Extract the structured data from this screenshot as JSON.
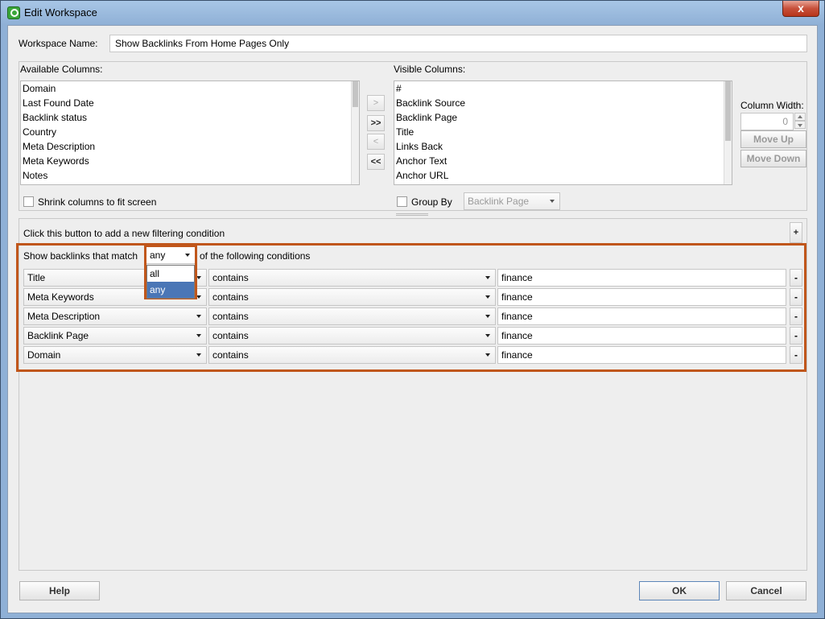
{
  "window": {
    "title": "Edit Workspace",
    "close_glyph": "x"
  },
  "workspace_name": {
    "label": "Workspace Name:",
    "value": "Show Backlinks From Home Pages Only"
  },
  "available_columns": {
    "label": "Available Columns:",
    "items": [
      "Domain",
      "Last Found Date",
      "Backlink status",
      "Country",
      "Meta Description",
      "Meta Keywords",
      "Notes"
    ]
  },
  "visible_columns": {
    "label": "Visible Columns:",
    "items": [
      "#",
      "Backlink Source",
      "Backlink Page",
      "Title",
      "Links Back",
      "Anchor Text",
      "Anchor URL"
    ]
  },
  "transfer_buttons": {
    "move_right": ">",
    "move_all_right": ">>",
    "move_left": "<",
    "move_all_left": "<<"
  },
  "column_width": {
    "label": "Column Width:",
    "value": "0"
  },
  "move_up_label": "Move Up",
  "move_down_label": "Move Down",
  "shrink_columns_label": "Shrink columns to fit screen",
  "group_by": {
    "label": "Group By",
    "value": "Backlink Page"
  },
  "filter": {
    "add_hint": "Click this button to add a new filtering condition",
    "add_label": "+",
    "match_prefix": "Show backlinks that match",
    "match_value": "any",
    "match_suffix": "of the following conditions",
    "match_options": [
      "all",
      "any"
    ],
    "selected_option": "any",
    "remove_label": "-",
    "conditions": [
      {
        "field": "Title",
        "operator": "contains",
        "value": "finance"
      },
      {
        "field": "Meta Keywords",
        "operator": "contains",
        "value": "finance"
      },
      {
        "field": "Meta Description",
        "operator": "contains",
        "value": "finance"
      },
      {
        "field": "Backlink Page",
        "operator": "contains",
        "value": "finance"
      },
      {
        "field": "Domain",
        "operator": "contains",
        "value": "finance"
      }
    ]
  },
  "footer": {
    "help_label": "Help",
    "ok_label": "OK",
    "cancel_label": "Cancel"
  },
  "colors": {
    "highlight": "#c0561b",
    "selection": "#4a76b6"
  }
}
